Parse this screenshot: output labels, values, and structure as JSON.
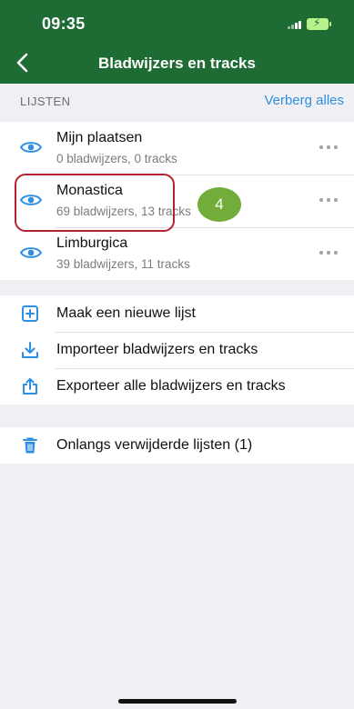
{
  "status_bar": {
    "time": "09:35"
  },
  "nav": {
    "title": "Bladwijzers en tracks"
  },
  "lists_section": {
    "title": "LIJSTEN",
    "action": "Verberg alles"
  },
  "lists": [
    {
      "title": "Mijn plaatsen",
      "subtitle": "0 bladwijzers, 0 tracks"
    },
    {
      "title": "Monastica",
      "subtitle": "69 bladwijzers, 13 tracks"
    },
    {
      "title": "Limburgica",
      "subtitle": "39 bladwijzers, 11 tracks"
    }
  ],
  "actions": {
    "create": "Maak een nieuwe lijst",
    "import": "Importeer bladwijzers en tracks",
    "export": "Exporteer alle bladwijzers en tracks"
  },
  "recently_deleted": {
    "label": "Onlangs verwijderde lijsten (1)"
  },
  "annotation": {
    "step": "4"
  },
  "colors": {
    "header": "#1f6b34",
    "accent": "#2f8fe0",
    "highlight": "#b3232f",
    "badge": "#72ad3b"
  }
}
